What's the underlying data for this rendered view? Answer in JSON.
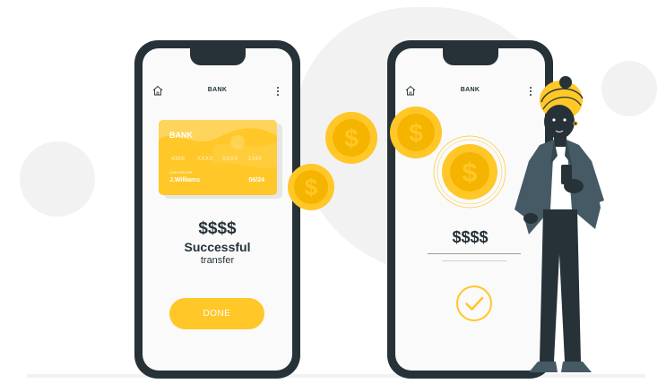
{
  "colors": {
    "accent": "#ffc727",
    "dark": "#263238",
    "screen": "#fafafa",
    "background_blob": "#f2f2f2"
  },
  "phone_left": {
    "header": {
      "title": "BANK",
      "home_icon": "home-icon",
      "menu_icon": "kebab-menu-icon"
    },
    "card": {
      "bank": "BANK",
      "number_groups": [
        "4356",
        "XXXX",
        "XXXX",
        "1342"
      ],
      "holder_label": "CARD HOLDER",
      "holder": "J.Williams",
      "expiry": "06/24"
    },
    "amount": "$$$$",
    "status": "Successful",
    "status_detail": "transfer",
    "done_button": "DONE"
  },
  "phone_right": {
    "header": {
      "title": "BANK",
      "home_icon": "home-icon",
      "menu_icon": "kebab-menu-icon"
    },
    "amount": "$$$$",
    "check_icon": "check-circle-icon"
  },
  "coins": {
    "symbol": "$"
  }
}
